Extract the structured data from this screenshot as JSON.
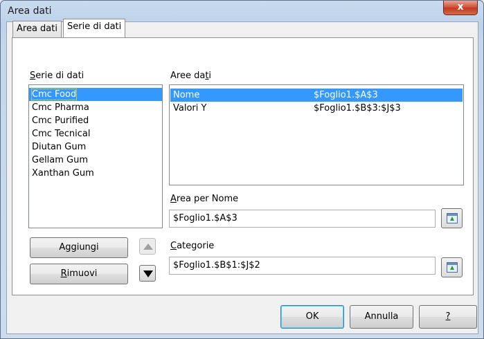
{
  "window": {
    "title": "Area dati",
    "close_glyph": "x"
  },
  "tabs": [
    {
      "label": "Area dati",
      "active": false
    },
    {
      "label": "Serie di dati",
      "active": true
    }
  ],
  "series_panel": {
    "label": "Serie di dati",
    "items": [
      "Cmc Food",
      "Cmc Pharma",
      "Cmc Purified",
      "Cmc Tecnical",
      "Diutan Gum",
      "Gellam Gum",
      "Xanthan Gum"
    ],
    "selected": "Cmc Food"
  },
  "data_ranges": {
    "label": "Aree dati",
    "rows": [
      {
        "name": "Nome",
        "range": "$Foglio1.$A$3",
        "selected": true
      },
      {
        "name": "Valori Y",
        "range": "$Foglio1.$B$3:$J$3",
        "selected": false
      }
    ]
  },
  "name_range": {
    "label": "Area per Nome",
    "value": "$Foglio1.$A$3"
  },
  "categories": {
    "label": "Categorie",
    "value": "$Foglio1.$B$1:$J$2"
  },
  "buttons": {
    "add": "Aggiungi",
    "remove": "Rimuovi",
    "ok": "OK",
    "cancel": "Annulla",
    "help": "?"
  },
  "icons": {
    "up": "arrow-up-icon",
    "down": "arrow-down-icon",
    "shrink": "shrink-dialog-icon"
  },
  "colors": {
    "selection": "#3399ff"
  }
}
